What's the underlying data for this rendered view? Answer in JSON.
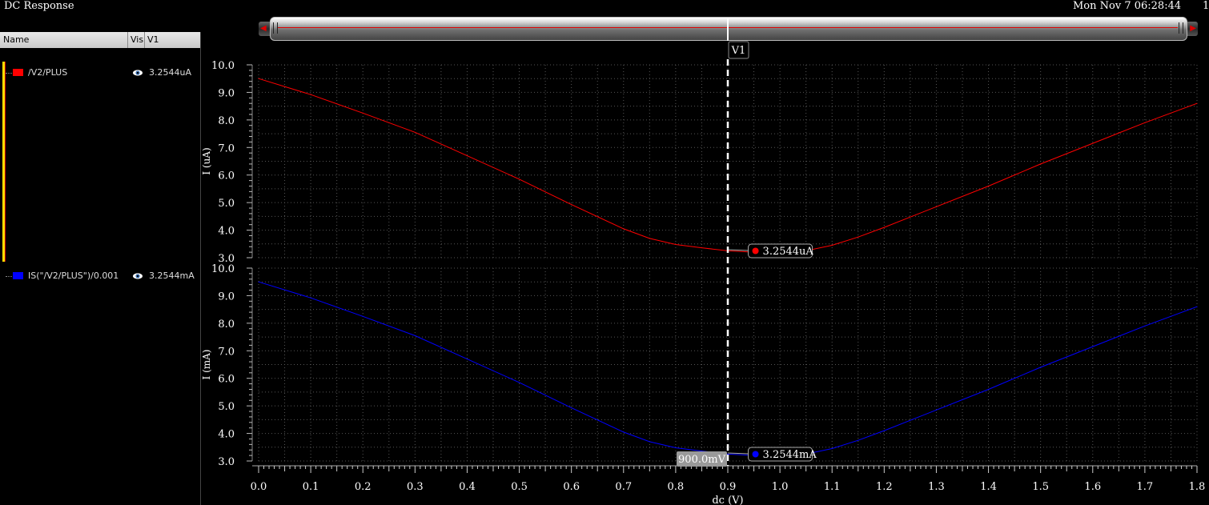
{
  "window": {
    "title": "DC Response",
    "datetime": "Mon Nov 7 06:28:44",
    "datetime_tail": "1"
  },
  "legend_panel": {
    "headers": {
      "name": "Name",
      "vis": "Vis",
      "cursor": "V1"
    },
    "traces": [
      {
        "name": "/V2/PLUS",
        "color": "#ff0000",
        "value": "3.2544uA",
        "icon": "eye-icon"
      },
      {
        "name": "IS(\"/V2/PLUS\")/0.001",
        "color": "#0000ff",
        "value": "3.2544mA",
        "icon": "eye-icon"
      }
    ]
  },
  "cursor": {
    "name": "V1",
    "x_value": 0.9,
    "x_label": "900.0mV",
    "marker_x": 0.95
  },
  "chart_data": [
    {
      "type": "line",
      "ylabel": "I (uA)",
      "ylim": [
        3.0,
        10.0
      ],
      "yticks": [
        "3.0",
        "4.0",
        "5.0",
        "6.0",
        "7.0",
        "8.0",
        "9.0",
        "10.0"
      ],
      "xlim": [
        0.0,
        1.8
      ],
      "grid": true,
      "cursor_readout": "3.2544uA",
      "series": [
        {
          "name": "/V2/PLUS",
          "color": "#ff0000",
          "x": [
            0.0,
            0.1,
            0.2,
            0.3,
            0.4,
            0.5,
            0.6,
            0.7,
            0.75,
            0.8,
            0.85,
            0.9,
            0.95,
            1.0,
            1.05,
            1.1,
            1.15,
            1.2,
            1.3,
            1.4,
            1.5,
            1.6,
            1.7,
            1.8
          ],
          "y": [
            9.5,
            8.92,
            8.25,
            7.55,
            6.7,
            5.85,
            4.93,
            4.05,
            3.7,
            3.48,
            3.36,
            3.25,
            3.2,
            3.2,
            3.25,
            3.45,
            3.75,
            4.1,
            4.85,
            5.6,
            6.4,
            7.15,
            7.9,
            8.6
          ]
        }
      ]
    },
    {
      "type": "line",
      "ylabel": "I (mA)",
      "ylim": [
        3.0,
        10.0
      ],
      "yticks": [
        "3.0",
        "4.0",
        "5.0",
        "6.0",
        "7.0",
        "8.0",
        "9.0",
        "10.0"
      ],
      "xlim": [
        0.0,
        1.8
      ],
      "xlabel": "dc (V)",
      "xticks": [
        "0.0",
        "0.1",
        "0.2",
        "0.3",
        "0.4",
        "0.5",
        "0.6",
        "0.7",
        "0.8",
        "0.9",
        "1.0",
        "1.1",
        "1.2",
        "1.3",
        "1.4",
        "1.5",
        "1.6",
        "1.7",
        "1.8"
      ],
      "grid": true,
      "cursor_readout": "3.2544mA",
      "series": [
        {
          "name": "IS(\"/V2/PLUS\")/0.001",
          "color": "#0000ff",
          "x": [
            0.0,
            0.1,
            0.2,
            0.3,
            0.4,
            0.5,
            0.6,
            0.7,
            0.75,
            0.8,
            0.85,
            0.9,
            0.95,
            1.0,
            1.05,
            1.1,
            1.15,
            1.2,
            1.3,
            1.4,
            1.5,
            1.6,
            1.7,
            1.8
          ],
          "y": [
            9.5,
            8.92,
            8.25,
            7.55,
            6.7,
            5.85,
            4.93,
            4.05,
            3.7,
            3.48,
            3.36,
            3.25,
            3.2,
            3.2,
            3.25,
            3.45,
            3.75,
            4.1,
            4.85,
            5.6,
            6.4,
            7.15,
            7.9,
            8.6
          ]
        }
      ]
    }
  ]
}
